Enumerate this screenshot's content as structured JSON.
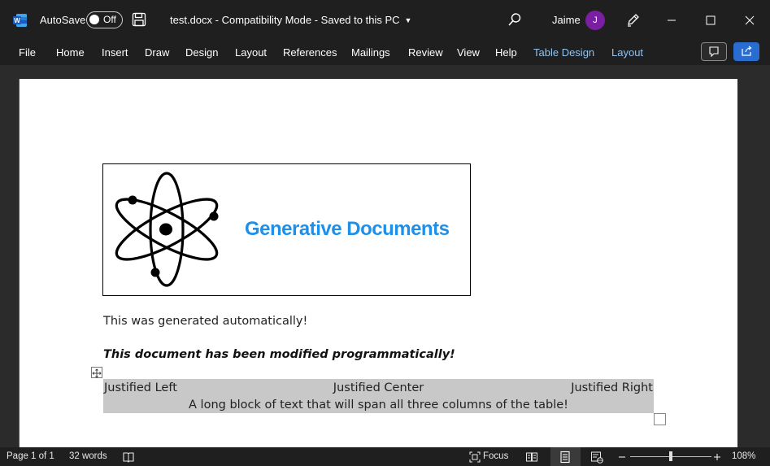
{
  "titlebar": {
    "autosave_label": "AutoSave",
    "autosave_state": "Off",
    "document_title": "test.docx  -  Compatibility Mode  -  Saved to this PC",
    "user_name": "Jaime",
    "avatar_initial": "J",
    "avatar_color": "#7b1fa2"
  },
  "ribbon": {
    "tabs": [
      "File",
      "Home",
      "Insert",
      "Draw",
      "Design",
      "Layout",
      "References",
      "Mailings",
      "Review",
      "View",
      "Help",
      "Table Design",
      "Layout"
    ]
  },
  "document": {
    "brand_text": "Generative Documents",
    "brand_color": "#1f8fe8",
    "paragraph1": "This was generated automatically!",
    "paragraph2": "This document has been modified programmatically!",
    "table": {
      "row1": [
        "Justified Left",
        "Justified Center",
        "Justified Right"
      ],
      "row2": "A long block of text that will span all three columns of the table!"
    }
  },
  "statusbar": {
    "page": "Page 1 of 1",
    "words": "32 words",
    "focus": "Focus",
    "zoom": "108%"
  }
}
